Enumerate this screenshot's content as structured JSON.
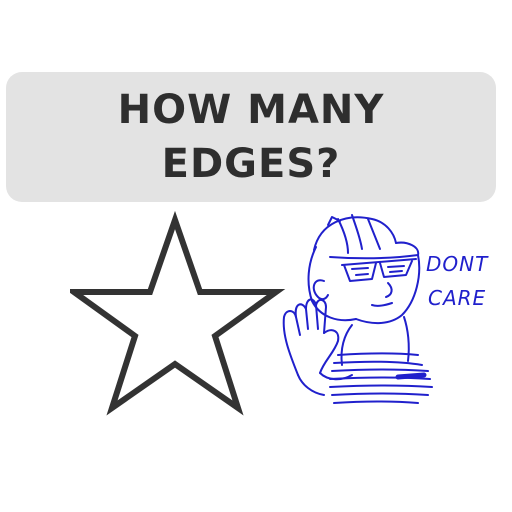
{
  "question": {
    "text": "HOW MANY EDGES?"
  },
  "star": {
    "icon": "star-outline-icon",
    "stroke_color": "#333333"
  },
  "doodle": {
    "icon": "guy-in-cap-sunglasses-stop-hand-icon",
    "ink_color": "#2020cc",
    "caption_line1": "DONT",
    "caption_line2": "CARE"
  },
  "colors": {
    "question_box_bg": "#e3e3e3",
    "question_text": "#2e2e2e"
  }
}
